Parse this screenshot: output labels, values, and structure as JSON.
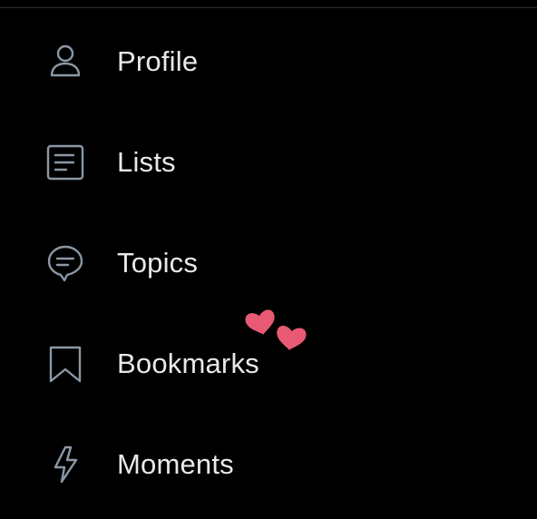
{
  "colors": {
    "background": "#000000",
    "text": "#e7e9ea",
    "icon_stroke": "#8b98a5",
    "divider": "#2f3336",
    "heart": "#e85a73"
  },
  "menu": {
    "items": [
      {
        "label": "Profile",
        "icon": "person-icon"
      },
      {
        "label": "Lists",
        "icon": "list-document-icon"
      },
      {
        "label": "Topics",
        "icon": "topics-bubble-icon"
      },
      {
        "label": "Bookmarks",
        "icon": "bookmark-icon"
      },
      {
        "label": "Moments",
        "icon": "lightning-icon"
      }
    ]
  },
  "sticker": {
    "icon": "hearts-sticker"
  }
}
